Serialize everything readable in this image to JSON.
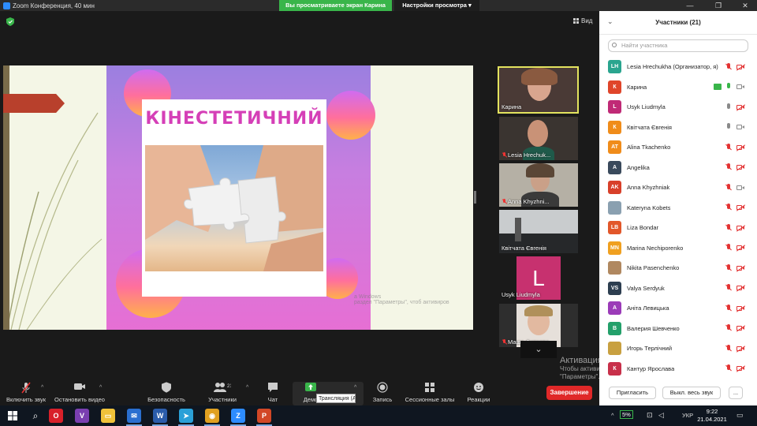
{
  "window": {
    "title": "Zoom Конференция, 40 мин",
    "viewing_banner": "Вы просматриваете экран Карина",
    "view_options": "Настройки просмотра",
    "minimize_glyph": "—",
    "restore_glyph": "❐",
    "close_glyph": "✕"
  },
  "meeting": {
    "view_label": "Вид",
    "slide": {
      "heading": "КІНЕСТЕТИЧНИЙ",
      "watermark_line1": "а Windows",
      "watermark_line2": "раздел \"Параметры\", чтоб активиров"
    },
    "thumbnails": [
      {
        "name": "Карина",
        "muted": false
      },
      {
        "name": "Lesia Hrechuk...",
        "muted": true
      },
      {
        "name": "Anna Khyzhni...",
        "muted": true
      },
      {
        "name": "Квітчата Євгенія",
        "muted": false
      },
      {
        "name": "Usyk Liudmyla",
        "muted": false,
        "letter": "L"
      },
      {
        "name": "Маша Фатеева",
        "muted": true
      }
    ],
    "scroll_glyph": "⌄"
  },
  "toolbar": {
    "mute_label": "Включить звук",
    "video_label": "Остановить видео",
    "security_label": "Безопасность",
    "participants_label": "Участники",
    "participants_count": "21",
    "chat_label": "Чат",
    "share_label": "Демо",
    "share_tooltip": "Трансляция (Alt+S)",
    "record_label": "Запись",
    "breakout_label": "Сессионные залы",
    "reactions_label": "Реакции",
    "end_label": "Завершение",
    "caret": "^"
  },
  "activation": {
    "title": "Активация Windows",
    "line1": "Чтобы активировать Windows, перейдите в раздел",
    "line2": "\"Параметры\"."
  },
  "participants_panel": {
    "title": "Участники (21)",
    "search_placeholder": "Найти участника",
    "invite_label": "Пригласить",
    "mute_all_label": "Выкл. весь звук",
    "more_label": "..."
  },
  "participants": [
    {
      "initials": "LH",
      "name": "Lesia Hrechukha (Организатор, я)",
      "color": "#2aa58f",
      "mic": "off",
      "cam": "off"
    },
    {
      "initials": "К",
      "name": "Карина",
      "color": "#e0452a",
      "mic": "on",
      "cam": "on",
      "sharing": true
    },
    {
      "initials": "L",
      "name": "Usyk Liudmyla",
      "color": "#c02a76",
      "mic": "on",
      "cam": "off"
    },
    {
      "initials": "К",
      "name": "Квітчата Євгенія",
      "color": "#f08c1a",
      "mic": "on",
      "cam": "on"
    },
    {
      "initials": "AT",
      "name": "Alina Tkachenko",
      "color": "#f08c1a",
      "mic": "off",
      "cam": "off"
    },
    {
      "initials": "A",
      "name": "Angelika",
      "color": "#3a4a5c",
      "mic": "off",
      "cam": "off"
    },
    {
      "initials": "AK",
      "name": "Anna Khyzhniak",
      "color": "#d8402a",
      "mic": "off",
      "cam": "on"
    },
    {
      "initials": "",
      "name": "Kateryna Kobets",
      "color": "#8aa0b0",
      "mic": "off",
      "cam": "off",
      "photo": true
    },
    {
      "initials": "LB",
      "name": "Liza Bondar",
      "color": "#e2572a",
      "mic": "off",
      "cam": "off"
    },
    {
      "initials": "MN",
      "name": "Marina Nechiporenko",
      "color": "#f0a020",
      "mic": "off",
      "cam": "off"
    },
    {
      "initials": "",
      "name": "Nikita Pasenchenko",
      "color": "#b08860",
      "mic": "off",
      "cam": "off",
      "photo": true
    },
    {
      "initials": "VS",
      "name": "Valya Serdyuk",
      "color": "#2d3e50",
      "mic": "off",
      "cam": "off"
    },
    {
      "initials": "A",
      "name": "Аніта Левицька",
      "color": "#9b3bb8",
      "mic": "off",
      "cam": "off"
    },
    {
      "initials": "В",
      "name": "Валерия Шевченко",
      "color": "#23a06a",
      "mic": "off",
      "cam": "off"
    },
    {
      "initials": "",
      "name": "Игорь Терлічний",
      "color": "#c8a040",
      "mic": "off",
      "cam": "off",
      "photo": true
    },
    {
      "initials": "К",
      "name": "Кантур Ярослава",
      "color": "#c8304a",
      "mic": "off",
      "cam": "off"
    }
  ],
  "taskbar": {
    "search_glyph": "⌕",
    "apps": [
      "O",
      "V",
      "▭",
      "✉",
      "W",
      "➤",
      "◉",
      "Z",
      "P"
    ],
    "battery": "5%",
    "lang": "УКР",
    "time": "9:22",
    "date": "21.04.2021",
    "tray_up": "^"
  },
  "colors": {
    "zoom_blue": "#2d8cff",
    "banner_green": "#39b54a",
    "end_red": "#e02828",
    "muted_red": "#e33333",
    "slide_heading": "#d53fb7"
  }
}
